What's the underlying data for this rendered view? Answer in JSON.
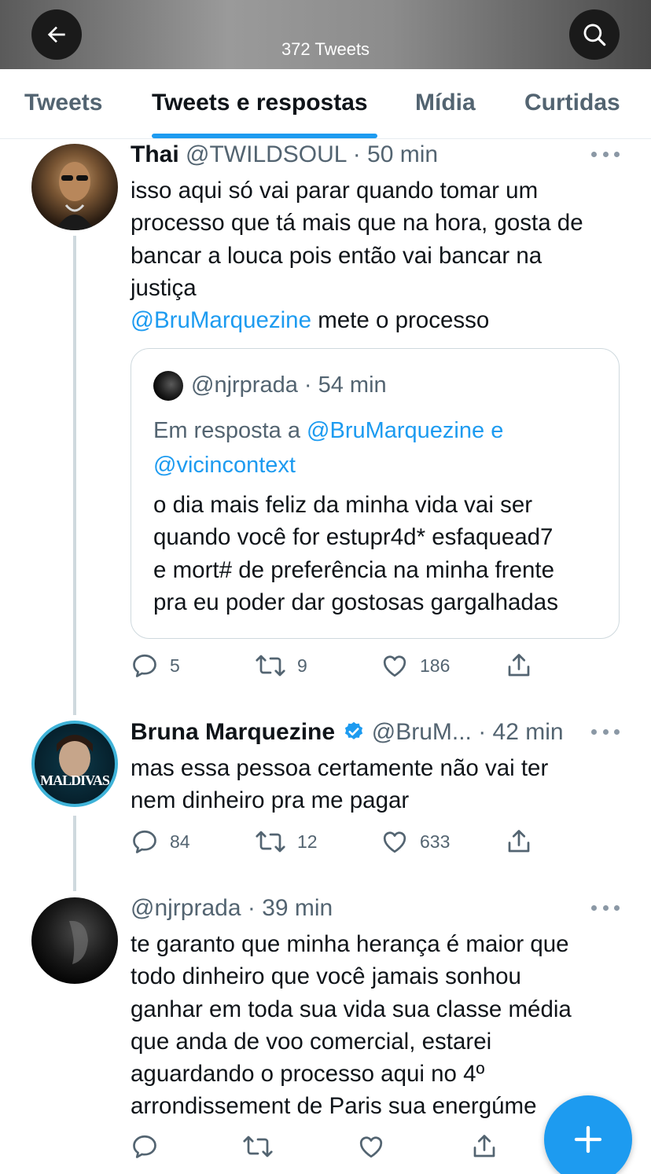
{
  "header": {
    "tweet_count": "372 Tweets",
    "back_icon": "back-arrow-icon",
    "search_icon": "search-icon"
  },
  "tabs": [
    {
      "label": "Tweets",
      "active": false
    },
    {
      "label": "Tweets e respostas",
      "active": true
    },
    {
      "label": "Mídia",
      "active": false
    },
    {
      "label": "Curtidas",
      "active": false
    }
  ],
  "tweets": [
    {
      "display_name": "Thai",
      "handle": "@TWILDSOUL",
      "time": "· 50 min",
      "text_lines": [
        "isso aqui só vai parar quando tomar um",
        "processo que tá mais que na hora, gosta de",
        "bancar a louca pois então vai bancar na",
        "justiça"
      ],
      "mention": "@BruMarquezine",
      "mention_suffix": " mete o processo",
      "quote": {
        "handle": "@njrprada",
        "time": "· 54 min",
        "reply_prefix": "Em resposta a ",
        "reply_mention_1": "@BruMarquezine",
        "reply_and": " e",
        "reply_mention_2": "@vicincontext",
        "text_lines": [
          "o dia mais feliz da minha vida vai ser",
          "quando você for estupr4d* esfaquead7",
          "e mort# de preferência na minha frente",
          "pra eu poder dar gostosas gargalhadas"
        ]
      },
      "replies": "5",
      "retweets": "9",
      "likes": "186"
    },
    {
      "display_name": "Bruna Marquezine",
      "handle": "@BruM...",
      "time": "· 42 min",
      "verified": true,
      "avatar_text": "MALDIVAS",
      "text_lines": [
        "mas essa pessoa certamente não vai ter",
        "nem dinheiro pra me pagar"
      ],
      "replies": "84",
      "retweets": "12",
      "likes": "633"
    },
    {
      "handle": "@njrprada",
      "time": "· 39 min",
      "text_lines": [
        "te garanto que minha herança é maior que",
        "todo dinheiro que você jamais sonhou",
        "ganhar em toda sua vida sua classe média",
        "que anda de voo comercial, estarei",
        "aguardando o processo aqui no 4º",
        "arrondissement de Paris sua energúme"
      ]
    }
  ],
  "colors": {
    "accent": "#1d9bf0",
    "secondary_text": "#536471",
    "primary_text": "#0f1419"
  }
}
